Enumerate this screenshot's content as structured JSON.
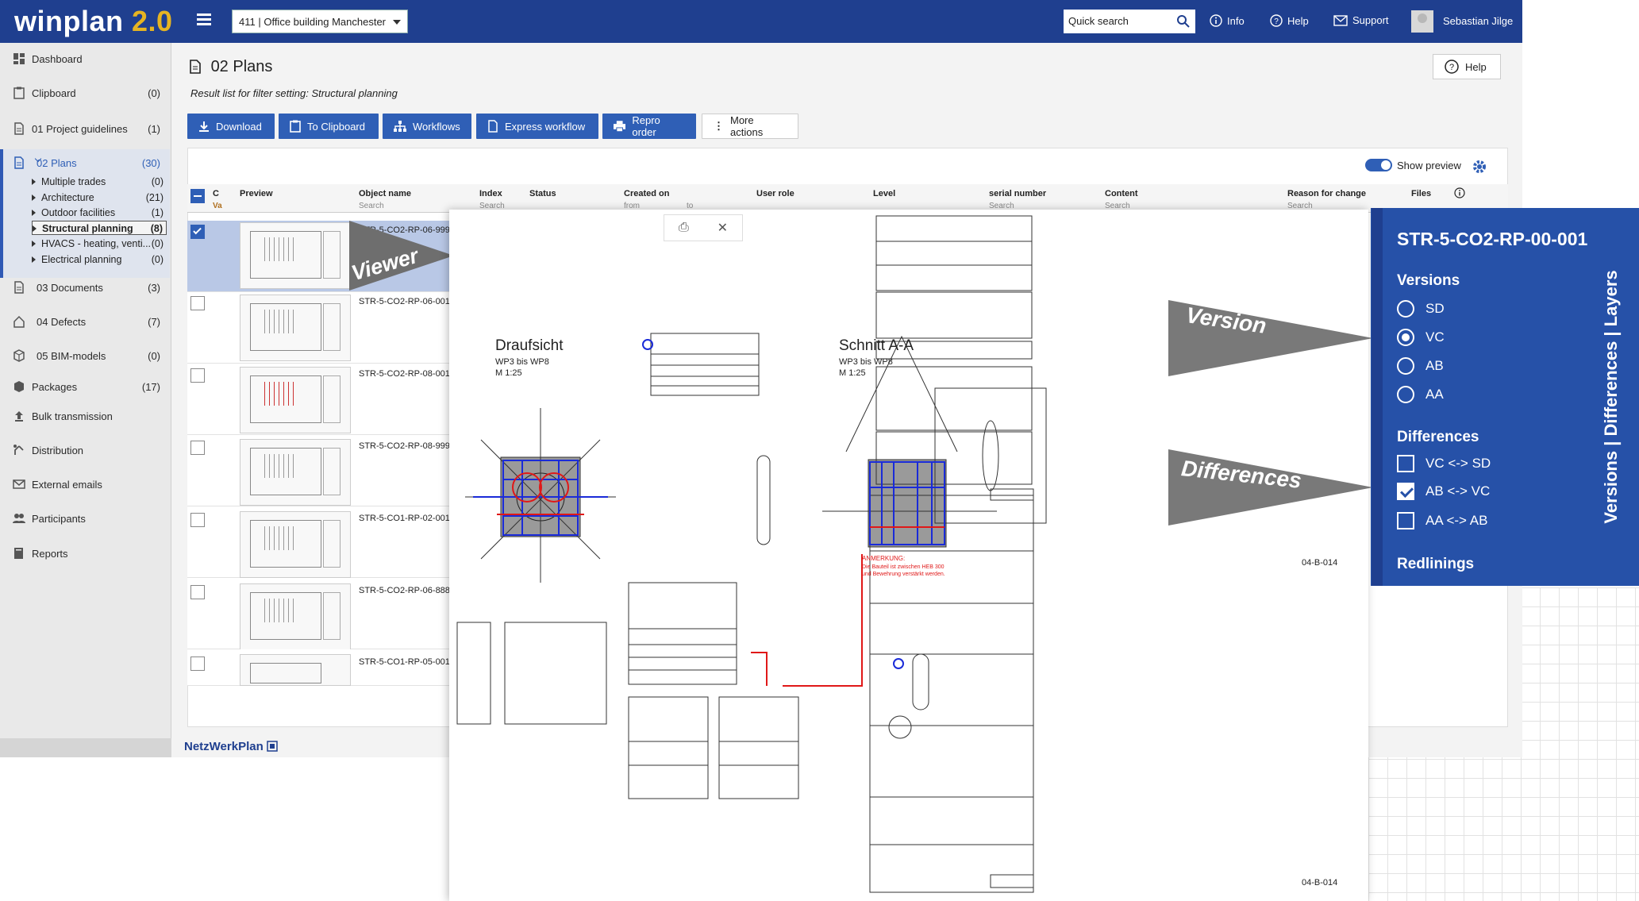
{
  "app": {
    "logo_main": "winplan",
    "logo_version": "2.0",
    "project": "411 | Office building Manchester",
    "search_placeholder": "Quick search",
    "links": {
      "info": "Info",
      "help": "Help",
      "support": "Support"
    },
    "user": "Sebastian Jilge",
    "brand_footer": "NetzWerkPlan"
  },
  "sidebar": {
    "items": [
      {
        "label": "Dashboard",
        "count": ""
      },
      {
        "label": "Clipboard",
        "count": "(0)"
      },
      {
        "label": "01 Project guidelines",
        "count": "(1)"
      },
      {
        "label": "02 Plans",
        "count": "(30)"
      },
      {
        "label": "03 Documents",
        "count": "(3)"
      },
      {
        "label": "04 Defects",
        "count": "(7)"
      },
      {
        "label": "05 BIM-models",
        "count": "(0)"
      },
      {
        "label": "Packages",
        "count": "(17)"
      },
      {
        "label": "Bulk transmission",
        "count": ""
      },
      {
        "label": "Distribution",
        "count": ""
      },
      {
        "label": "External emails",
        "count": ""
      },
      {
        "label": "Participants",
        "count": ""
      },
      {
        "label": "Reports",
        "count": ""
      }
    ],
    "sub": [
      {
        "label": "Multiple trades",
        "count": "(0)"
      },
      {
        "label": "Architecture",
        "count": "(21)"
      },
      {
        "label": "Outdoor facilities",
        "count": "(1)"
      },
      {
        "label": "Structural planning",
        "count": "(8)"
      },
      {
        "label": "HVACS - heating, venti...",
        "count": "(0)"
      },
      {
        "label": "Electrical planning",
        "count": "(0)"
      }
    ]
  },
  "main": {
    "title": "02 Plans",
    "subtitle": "Result list for filter setting: Structural planning",
    "help": "Help",
    "toolbar": {
      "download": "Download",
      "clipboard": "To Clipboard",
      "workflows": "Workflows",
      "express": "Express workflow",
      "repro": "Repro order",
      "more": "More actions"
    },
    "show_preview": "Show preview",
    "columns": {
      "preview": "Preview",
      "object_name": "Object name",
      "index": "Index",
      "status": "Status",
      "created_on": "Created on",
      "user_role": "User role",
      "level": "Level",
      "serial_number": "serial number",
      "content": "Content",
      "reason": "Reason for change",
      "files": "Files",
      "c_short": "C",
      "va_short": "Va"
    },
    "filter": {
      "search": "Search",
      "from": "from",
      "to": "to"
    },
    "rows": [
      {
        "name": "STR-5-CO2-RP-06-999",
        "selected": true
      },
      {
        "name": "STR-5-CO2-RP-06-001",
        "selected": false
      },
      {
        "name": "STR-5-CO2-RP-08-001",
        "selected": false
      },
      {
        "name": "STR-5-CO2-RP-08-999",
        "selected": false
      },
      {
        "name": "STR-5-CO1-RP-02-001",
        "selected": false
      },
      {
        "name": "STR-5-CO2-RP-06-888",
        "selected": false
      },
      {
        "name": "STR-5-CO1-RP-05-001",
        "selected": false
      }
    ]
  },
  "viewer": {
    "callout_viewer": "Viewer",
    "callout_version": "Version",
    "callout_differences": "Differences",
    "view1_title": "Draufsicht",
    "view1_sub1": "WP3 bis WP8",
    "view1_sub2": "M 1:25",
    "view2_title": "Schnitt A-A",
    "view2_sub1": "WP3 bis WP8",
    "view2_sub2": "M 1:25",
    "sheet_id": "04-B-014",
    "sheet_id_bottom": "04-B-014"
  },
  "panel": {
    "title": "STR-5-CO2-RP-00-001",
    "versions_heading": "Versions",
    "versions": [
      {
        "label": "SD",
        "on": false
      },
      {
        "label": "VC",
        "on": true
      },
      {
        "label": "AB",
        "on": false
      },
      {
        "label": "AA",
        "on": false
      }
    ],
    "differences_heading": "Differences",
    "differences": [
      {
        "label": "VC <-> SD",
        "on": false
      },
      {
        "label": "AB <-> VC",
        "on": true
      },
      {
        "label": "AA <-> AB",
        "on": false
      }
    ],
    "redlinings_heading": "Redlinings",
    "side_tabs": "Versions | Differences | Layers"
  },
  "colors": {
    "topbar": "#1f3f8f",
    "accent": "#2f5fb6",
    "panel": "#2651a8",
    "logo_version": "#e6b422",
    "redline": "#e01818",
    "blueline": "#1a2bd8"
  }
}
